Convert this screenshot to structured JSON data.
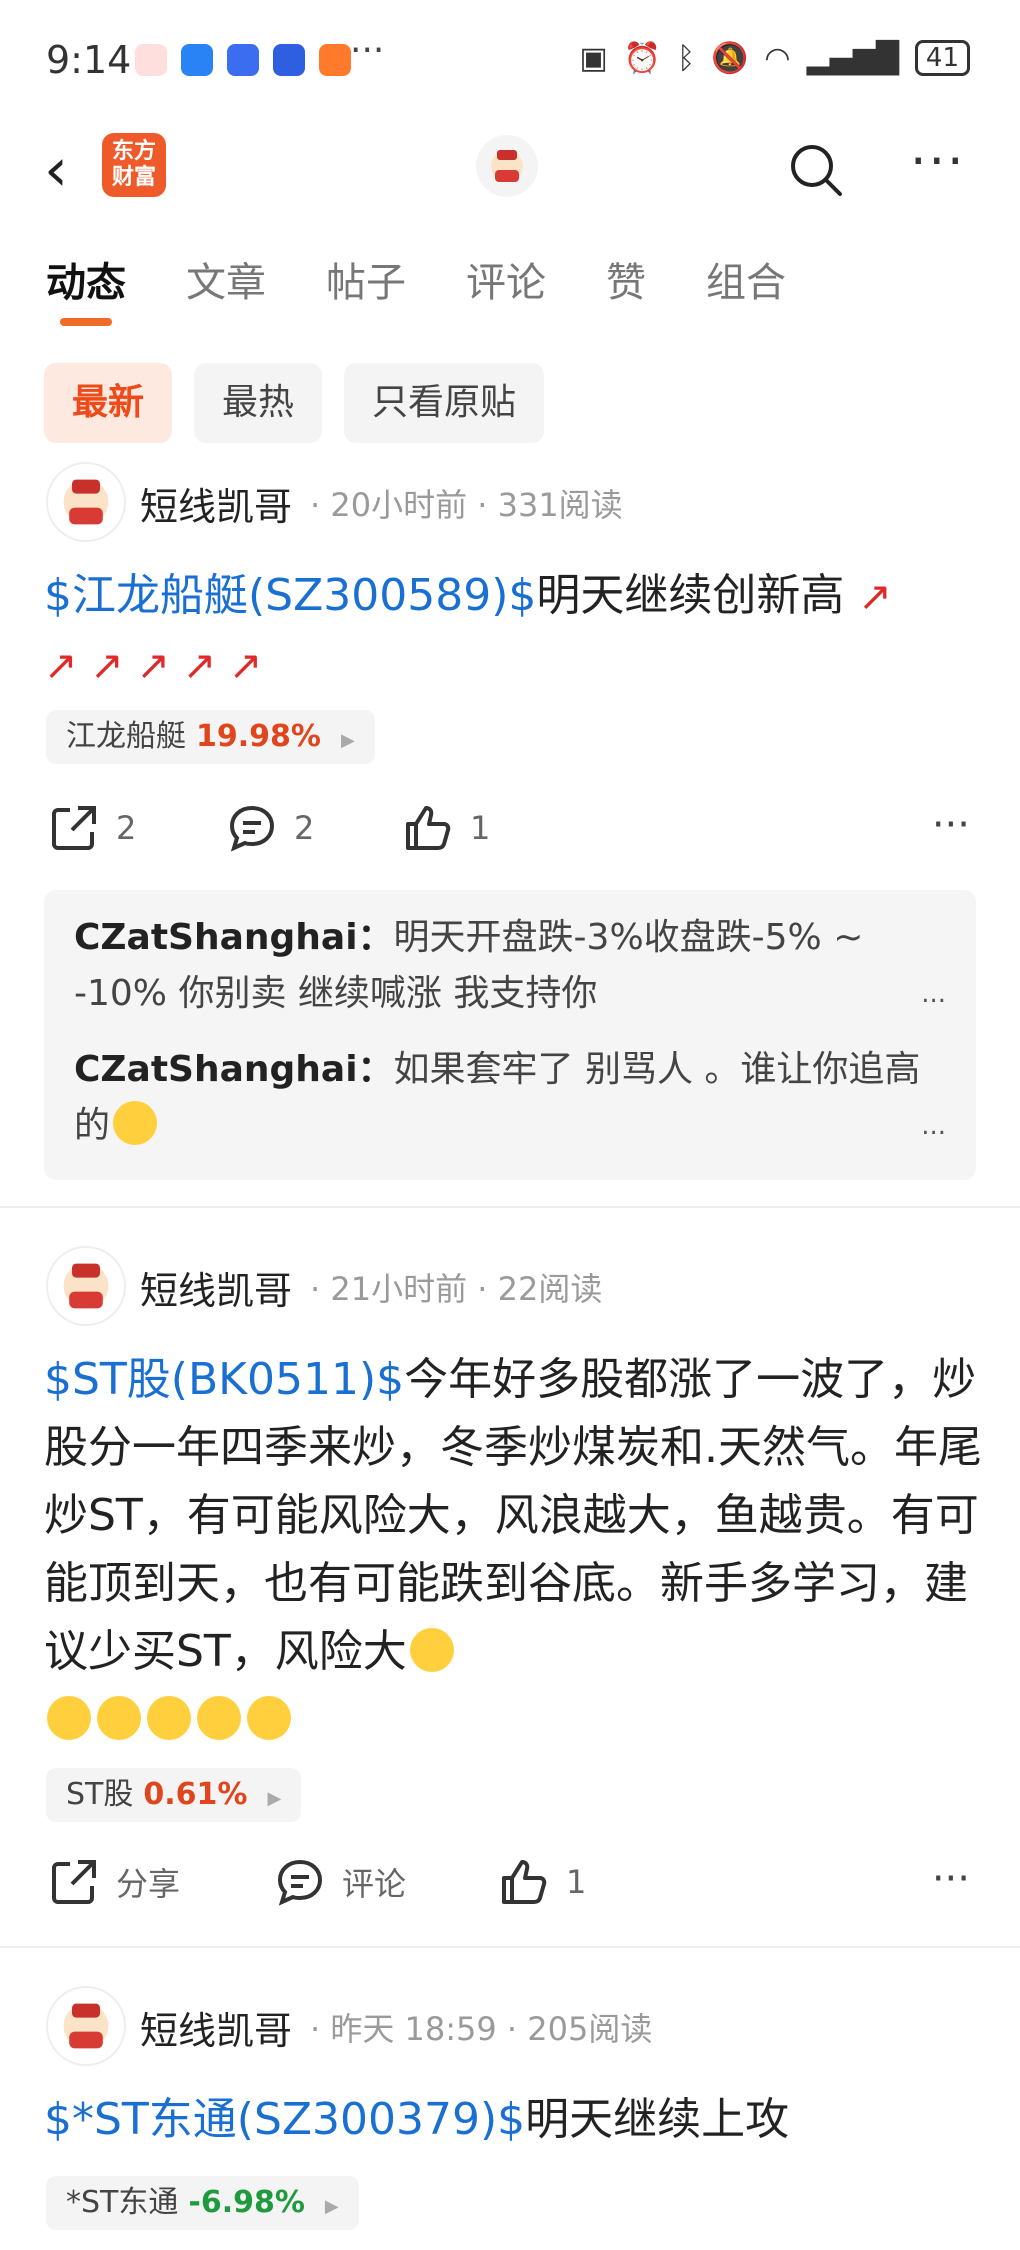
{
  "status_bar": {
    "time": "9:14",
    "battery": "41",
    "more": "···"
  },
  "nav": {
    "logo_text": "东方\n财富",
    "more": "···"
  },
  "tabs": [
    "动态",
    "文章",
    "帖子",
    "评论",
    "赞",
    "组合"
  ],
  "filters": [
    "最新",
    "最热",
    "只看原贴"
  ],
  "posts": [
    {
      "user": "短线凯哥",
      "time": "20小时前",
      "reads": "331阅读",
      "stock": "$江龙船艇(SZ300589)$",
      "text": "明天继续创新高",
      "tag_name": "江龙船艇",
      "tag_pct": "19.98%",
      "share": "2",
      "comment": "2",
      "like": "1",
      "comments": [
        {
          "user": "CZatShanghai：",
          "text": "明天开盘跌-3%收盘跌-5% ~ -10% 你别卖 继续喊涨 我支持你"
        },
        {
          "user": "CZatShanghai：",
          "text": "如果套牢了 别骂人 。谁让你追高的"
        }
      ]
    },
    {
      "user": "短线凯哥",
      "time": "21小时前",
      "reads": "22阅读",
      "stock": "$ST股(BK0511)$",
      "text": "今年好多股都涨了一波了，炒股分一年四季来炒，冬季炒煤炭和.天然气。年尾炒ST，有可能风险大，风浪越大，鱼越贵。有可能顶到天，也有可能跌到谷底。新手多学习，建议少买ST，风险大",
      "tag_name": "ST股",
      "tag_pct": "0.61%",
      "share": "分享",
      "comment": "评论",
      "like": "1"
    },
    {
      "user": "短线凯哥",
      "time": "昨天 18:59",
      "reads": "205阅读",
      "stock": "$*ST东通(SZ300379)$",
      "text": "明天继续上攻",
      "tag_name": "*ST东通",
      "tag_pct": "-6.98%"
    }
  ],
  "colors": {
    "accent": "#ef4a1a",
    "link": "#1a6fd3",
    "down": "#1f9a3c"
  }
}
